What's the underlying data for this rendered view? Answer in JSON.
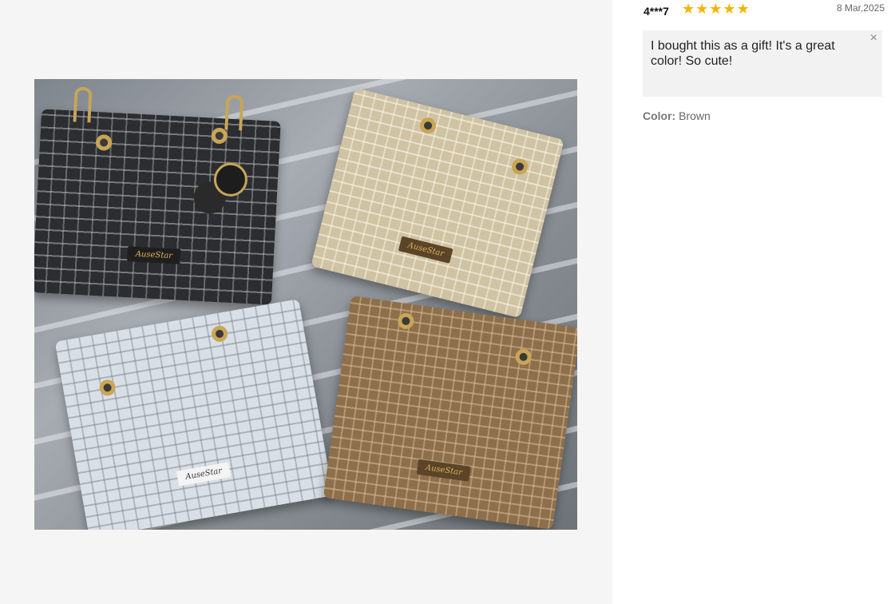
{
  "review": {
    "reviewer": "4***7",
    "rating": 5,
    "stars": [
      "★",
      "★",
      "★",
      "★",
      "★"
    ],
    "date": "8 Mar,2025",
    "text": "I bought this as a gift! It's a great color! So cute!",
    "close_icon": "×",
    "sku_label": "Color:",
    "sku_value": "Brown"
  },
  "photo": {
    "brand_text": "AuseStar"
  },
  "colors": {
    "star": "#f5b400",
    "panel_bg": "#f5f5f5",
    "review_box_bg": "#f2f2f2"
  }
}
